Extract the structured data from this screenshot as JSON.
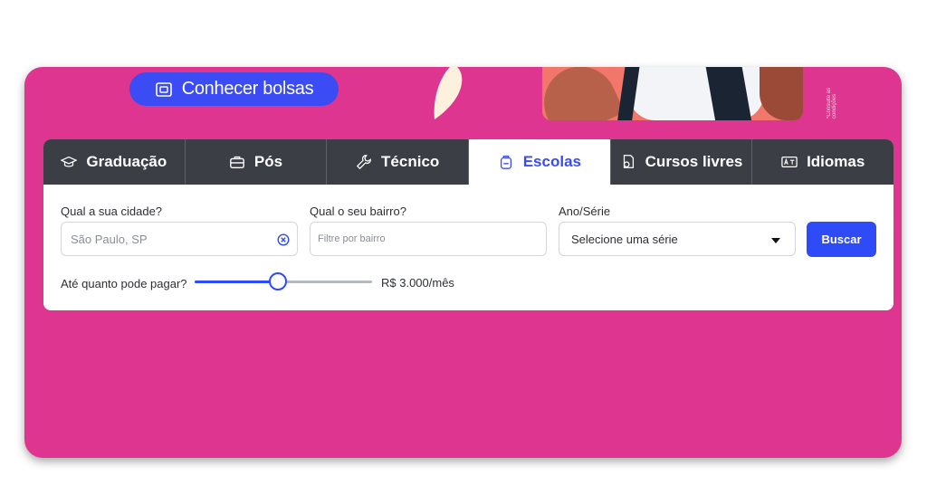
{
  "promo": {
    "button_label": "Conhecer bolsas",
    "side_note": "*Consulte as condições"
  },
  "tabs": [
    {
      "label": "Graduação",
      "icon": "graduation-cap-icon",
      "active": false
    },
    {
      "label": "Pós",
      "icon": "briefcase-icon",
      "active": false
    },
    {
      "label": "Técnico",
      "icon": "wrench-icon",
      "active": false
    },
    {
      "label": "Escolas",
      "icon": "backpack-icon",
      "active": true
    },
    {
      "label": "Cursos livres",
      "icon": "certificate-icon",
      "active": false
    },
    {
      "label": "Idiomas",
      "icon": "language-icon",
      "active": false
    }
  ],
  "form": {
    "city_label": "Qual a sua cidade?",
    "city_value": "São Paulo, SP",
    "neighborhood_label": "Qual o seu bairro?",
    "neighborhood_placeholder": "Filtre por bairro",
    "grade_label": "Ano/Série",
    "grade_value": "Selecione uma série",
    "search_label": "Buscar",
    "budget_label": "Até quanto pode pagar?",
    "budget_value": "R$ 3.000/mês",
    "budget_fraction": 0.47
  },
  "colors": {
    "accent": "#2f4bf7",
    "brand_pink": "#de3591",
    "tab_dark": "#3b3e44"
  }
}
